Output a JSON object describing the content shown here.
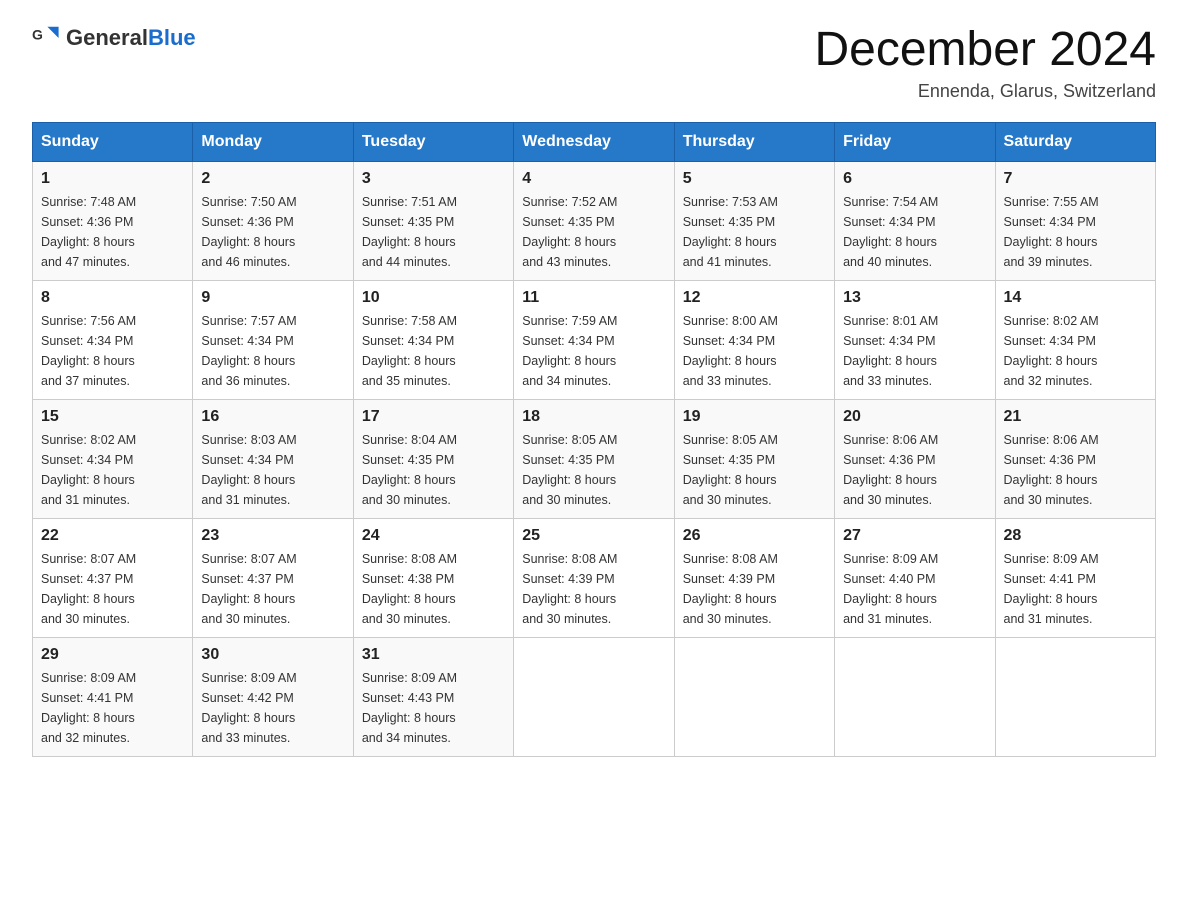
{
  "header": {
    "logo_general": "General",
    "logo_blue": "Blue",
    "title": "December 2024",
    "subtitle": "Ennenda, Glarus, Switzerland"
  },
  "days_of_week": [
    "Sunday",
    "Monday",
    "Tuesday",
    "Wednesday",
    "Thursday",
    "Friday",
    "Saturday"
  ],
  "weeks": [
    [
      {
        "day": "1",
        "sunrise": "7:48 AM",
        "sunset": "4:36 PM",
        "daylight": "8 hours and 47 minutes."
      },
      {
        "day": "2",
        "sunrise": "7:50 AM",
        "sunset": "4:36 PM",
        "daylight": "8 hours and 46 minutes."
      },
      {
        "day": "3",
        "sunrise": "7:51 AM",
        "sunset": "4:35 PM",
        "daylight": "8 hours and 44 minutes."
      },
      {
        "day": "4",
        "sunrise": "7:52 AM",
        "sunset": "4:35 PM",
        "daylight": "8 hours and 43 minutes."
      },
      {
        "day": "5",
        "sunrise": "7:53 AM",
        "sunset": "4:35 PM",
        "daylight": "8 hours and 41 minutes."
      },
      {
        "day": "6",
        "sunrise": "7:54 AM",
        "sunset": "4:34 PM",
        "daylight": "8 hours and 40 minutes."
      },
      {
        "day": "7",
        "sunrise": "7:55 AM",
        "sunset": "4:34 PM",
        "daylight": "8 hours and 39 minutes."
      }
    ],
    [
      {
        "day": "8",
        "sunrise": "7:56 AM",
        "sunset": "4:34 PM",
        "daylight": "8 hours and 37 minutes."
      },
      {
        "day": "9",
        "sunrise": "7:57 AM",
        "sunset": "4:34 PM",
        "daylight": "8 hours and 36 minutes."
      },
      {
        "day": "10",
        "sunrise": "7:58 AM",
        "sunset": "4:34 PM",
        "daylight": "8 hours and 35 minutes."
      },
      {
        "day": "11",
        "sunrise": "7:59 AM",
        "sunset": "4:34 PM",
        "daylight": "8 hours and 34 minutes."
      },
      {
        "day": "12",
        "sunrise": "8:00 AM",
        "sunset": "4:34 PM",
        "daylight": "8 hours and 33 minutes."
      },
      {
        "day": "13",
        "sunrise": "8:01 AM",
        "sunset": "4:34 PM",
        "daylight": "8 hours and 33 minutes."
      },
      {
        "day": "14",
        "sunrise": "8:02 AM",
        "sunset": "4:34 PM",
        "daylight": "8 hours and 32 minutes."
      }
    ],
    [
      {
        "day": "15",
        "sunrise": "8:02 AM",
        "sunset": "4:34 PM",
        "daylight": "8 hours and 31 minutes."
      },
      {
        "day": "16",
        "sunrise": "8:03 AM",
        "sunset": "4:34 PM",
        "daylight": "8 hours and 31 minutes."
      },
      {
        "day": "17",
        "sunrise": "8:04 AM",
        "sunset": "4:35 PM",
        "daylight": "8 hours and 30 minutes."
      },
      {
        "day": "18",
        "sunrise": "8:05 AM",
        "sunset": "4:35 PM",
        "daylight": "8 hours and 30 minutes."
      },
      {
        "day": "19",
        "sunrise": "8:05 AM",
        "sunset": "4:35 PM",
        "daylight": "8 hours and 30 minutes."
      },
      {
        "day": "20",
        "sunrise": "8:06 AM",
        "sunset": "4:36 PM",
        "daylight": "8 hours and 30 minutes."
      },
      {
        "day": "21",
        "sunrise": "8:06 AM",
        "sunset": "4:36 PM",
        "daylight": "8 hours and 30 minutes."
      }
    ],
    [
      {
        "day": "22",
        "sunrise": "8:07 AM",
        "sunset": "4:37 PM",
        "daylight": "8 hours and 30 minutes."
      },
      {
        "day": "23",
        "sunrise": "8:07 AM",
        "sunset": "4:37 PM",
        "daylight": "8 hours and 30 minutes."
      },
      {
        "day": "24",
        "sunrise": "8:08 AM",
        "sunset": "4:38 PM",
        "daylight": "8 hours and 30 minutes."
      },
      {
        "day": "25",
        "sunrise": "8:08 AM",
        "sunset": "4:39 PM",
        "daylight": "8 hours and 30 minutes."
      },
      {
        "day": "26",
        "sunrise": "8:08 AM",
        "sunset": "4:39 PM",
        "daylight": "8 hours and 30 minutes."
      },
      {
        "day": "27",
        "sunrise": "8:09 AM",
        "sunset": "4:40 PM",
        "daylight": "8 hours and 31 minutes."
      },
      {
        "day": "28",
        "sunrise": "8:09 AM",
        "sunset": "4:41 PM",
        "daylight": "8 hours and 31 minutes."
      }
    ],
    [
      {
        "day": "29",
        "sunrise": "8:09 AM",
        "sunset": "4:41 PM",
        "daylight": "8 hours and 32 minutes."
      },
      {
        "day": "30",
        "sunrise": "8:09 AM",
        "sunset": "4:42 PM",
        "daylight": "8 hours and 33 minutes."
      },
      {
        "day": "31",
        "sunrise": "8:09 AM",
        "sunset": "4:43 PM",
        "daylight": "8 hours and 34 minutes."
      },
      null,
      null,
      null,
      null
    ]
  ],
  "labels": {
    "sunrise": "Sunrise:",
    "sunset": "Sunset:",
    "daylight": "Daylight:"
  }
}
